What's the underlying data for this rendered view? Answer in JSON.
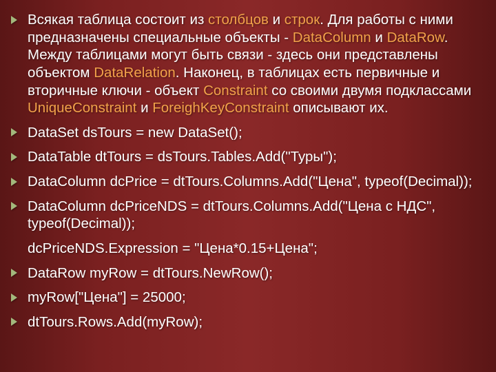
{
  "para": {
    "t1": "Всякая таблица состоит из ",
    "cols": "столбцов",
    "t2": " и ",
    "rows": "строк",
    "t3": ". Для работы с ними предназначены специальные объекты - ",
    "dc": "DataColumn",
    "t4": " и ",
    "dr": "DataRow",
    "t5": ". Между таблицами могут быть связи - здесь они представлены объектом ",
    "drel": "DataRelation",
    "t6": ". Наконец, в таблицах есть первичные и вторичные ключи - объект ",
    "cons": "Constraint",
    "t7": " со своими двумя подклассами ",
    "uc": "UniqueConstraint",
    "t8": " и ",
    "fkc": "ForeighKeyConstraint",
    "t9": " описывают их."
  },
  "code": {
    "l1": " DataSet dsTours = new DataSet();",
    "l2": " DataTable dtTours = dsTours.Tables.Add(\"Туры\");",
    "l3": "DataColumn dcPrice = dtTours.Columns.Add(\"Цена\", typeof(Decimal));",
    "l4": "DataColumn dcPriceNDS = dtTours.Columns.Add(\"Цена с НДС\", typeof(Decimal));",
    "l4b": "dcPriceNDS.Expression = \"Цена*0.15+Цена\";",
    "l5": "DataRow myRow = dtTours.NewRow();",
    "l6": "myRow[\"Цена\"] = 25000;",
    "l7": "dtTours.Rows.Add(myRow);"
  }
}
